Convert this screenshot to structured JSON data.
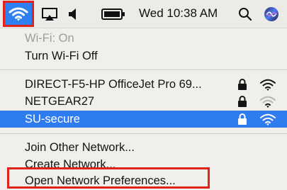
{
  "menubar": {
    "clock": "Wed 10:38 AM",
    "icons": [
      "wifi-icon",
      "airplay-icon",
      "volume-icon",
      "battery-icon",
      "search-icon",
      "siri-icon"
    ]
  },
  "menu": {
    "status": "Wi-Fi: On",
    "toggle": "Turn Wi-Fi Off",
    "networks": [
      {
        "name": "DIRECT-F5-HP OfficeJet Pro 69...",
        "locked": true,
        "signal": "full"
      },
      {
        "name": "NETGEAR27",
        "locked": true,
        "signal": "weak"
      },
      {
        "name": "SU-secure",
        "locked": true,
        "signal": "full",
        "selected": true
      }
    ],
    "join_other": "Join Other Network...",
    "create": "Create Network...",
    "open_prefs": "Open Network Preferences..."
  },
  "colors": {
    "selection": "#2f7cf0",
    "annotation_box": "#e2231a"
  }
}
